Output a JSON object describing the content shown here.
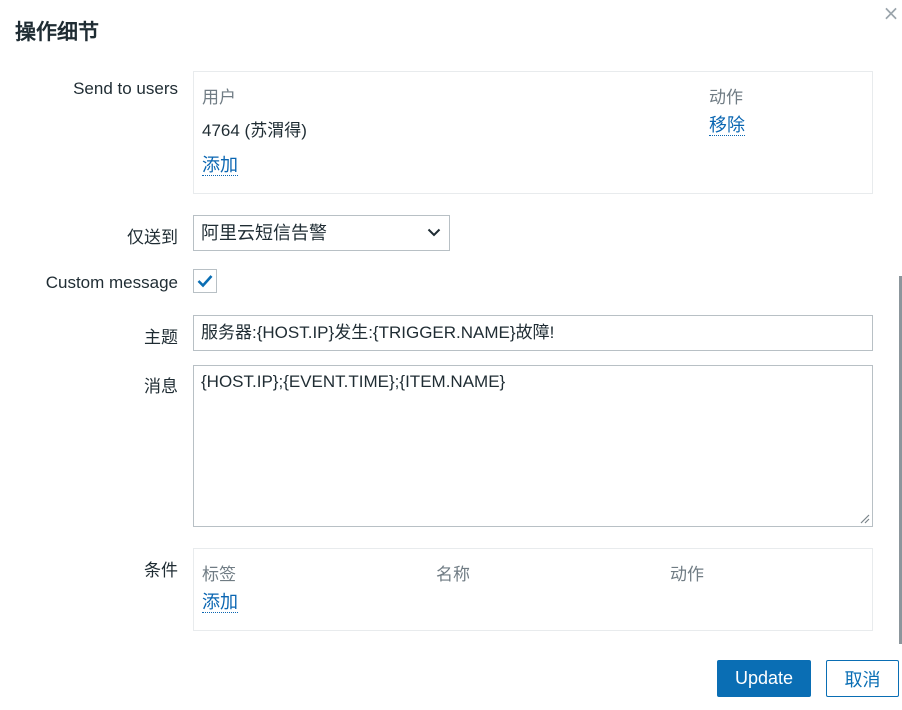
{
  "dialog": {
    "title": "操作细节",
    "close_icon": "×"
  },
  "send_to_users": {
    "label": "Send to users",
    "columns": {
      "user": "用户",
      "action": "动作"
    },
    "rows": [
      {
        "user": "4764 (苏渭得)",
        "action": "移除"
      }
    ],
    "add_label": "添加"
  },
  "send_only_to": {
    "label": "仅送到",
    "selected": "阿里云短信告警"
  },
  "custom_message": {
    "label": "Custom message",
    "checked": true
  },
  "subject": {
    "label": "主题",
    "value": "服务器:{HOST.IP}发生:{TRIGGER.NAME}故障!"
  },
  "message": {
    "label": "消息",
    "value": "{HOST.IP};{EVENT.TIME};{ITEM.NAME}"
  },
  "conditions": {
    "label": "条件",
    "columns": {
      "tag": "标签",
      "name": "名称",
      "action": "动作"
    },
    "add_label": "添加"
  },
  "footer": {
    "update_label": "Update",
    "cancel_label": "取消"
  },
  "colors": {
    "primary": "#0a6eb4",
    "link": "#0a66b2",
    "border": "#b8c0c5",
    "muted": "#707c84"
  }
}
